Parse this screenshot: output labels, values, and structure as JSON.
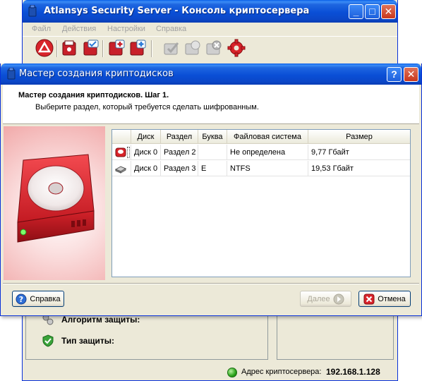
{
  "main_window": {
    "title": "Atlansys Security Server - Консоль криптосервера",
    "menu": [
      "Файл",
      "Действия",
      "Настройки",
      "Справка"
    ],
    "toolbar_icons": [
      "logo-icon",
      "disk-encrypt-icon",
      "disk-check-icon",
      "disk-add-icon",
      "disk-add-blue-icon",
      "verify-icon",
      "disk-check-gray-icon",
      "disk-remove-icon",
      "settings-gear-icon"
    ],
    "info": {
      "algorithm_label": "Алгоритм защиты:",
      "protection_label": "Тип защиты:"
    },
    "status": {
      "label": "Адрес криптосервера:",
      "address": "192.168.1.128"
    }
  },
  "wizard": {
    "title": "Мастер создания криптодисков",
    "heading": "Мастер создания криптодисков. Шаг 1.",
    "subheading": "Выберите раздел, который требуется сделать шифрованным.",
    "columns": [
      "",
      "Диск",
      "Раздел",
      "Буква",
      "Файловая система",
      "Размер"
    ],
    "rows": [
      {
        "icon": "red-disk-icon",
        "disk": "Диск 0",
        "partition": "Раздел 2",
        "letter": "",
        "fs": "Не определена",
        "size": "9,77 Гбайт"
      },
      {
        "icon": "gray-disk-icon",
        "disk": "Диск 0",
        "partition": "Раздел 3",
        "letter": "E",
        "fs": "NTFS",
        "size": "19,53 Гбайт"
      }
    ],
    "buttons": {
      "help": "Справка",
      "next": "Далее",
      "cancel": "Отмена"
    }
  },
  "colors": {
    "titlebar": "#0a4fd6",
    "accent_red": "#d8232a",
    "status_green": "#2aa31a"
  }
}
